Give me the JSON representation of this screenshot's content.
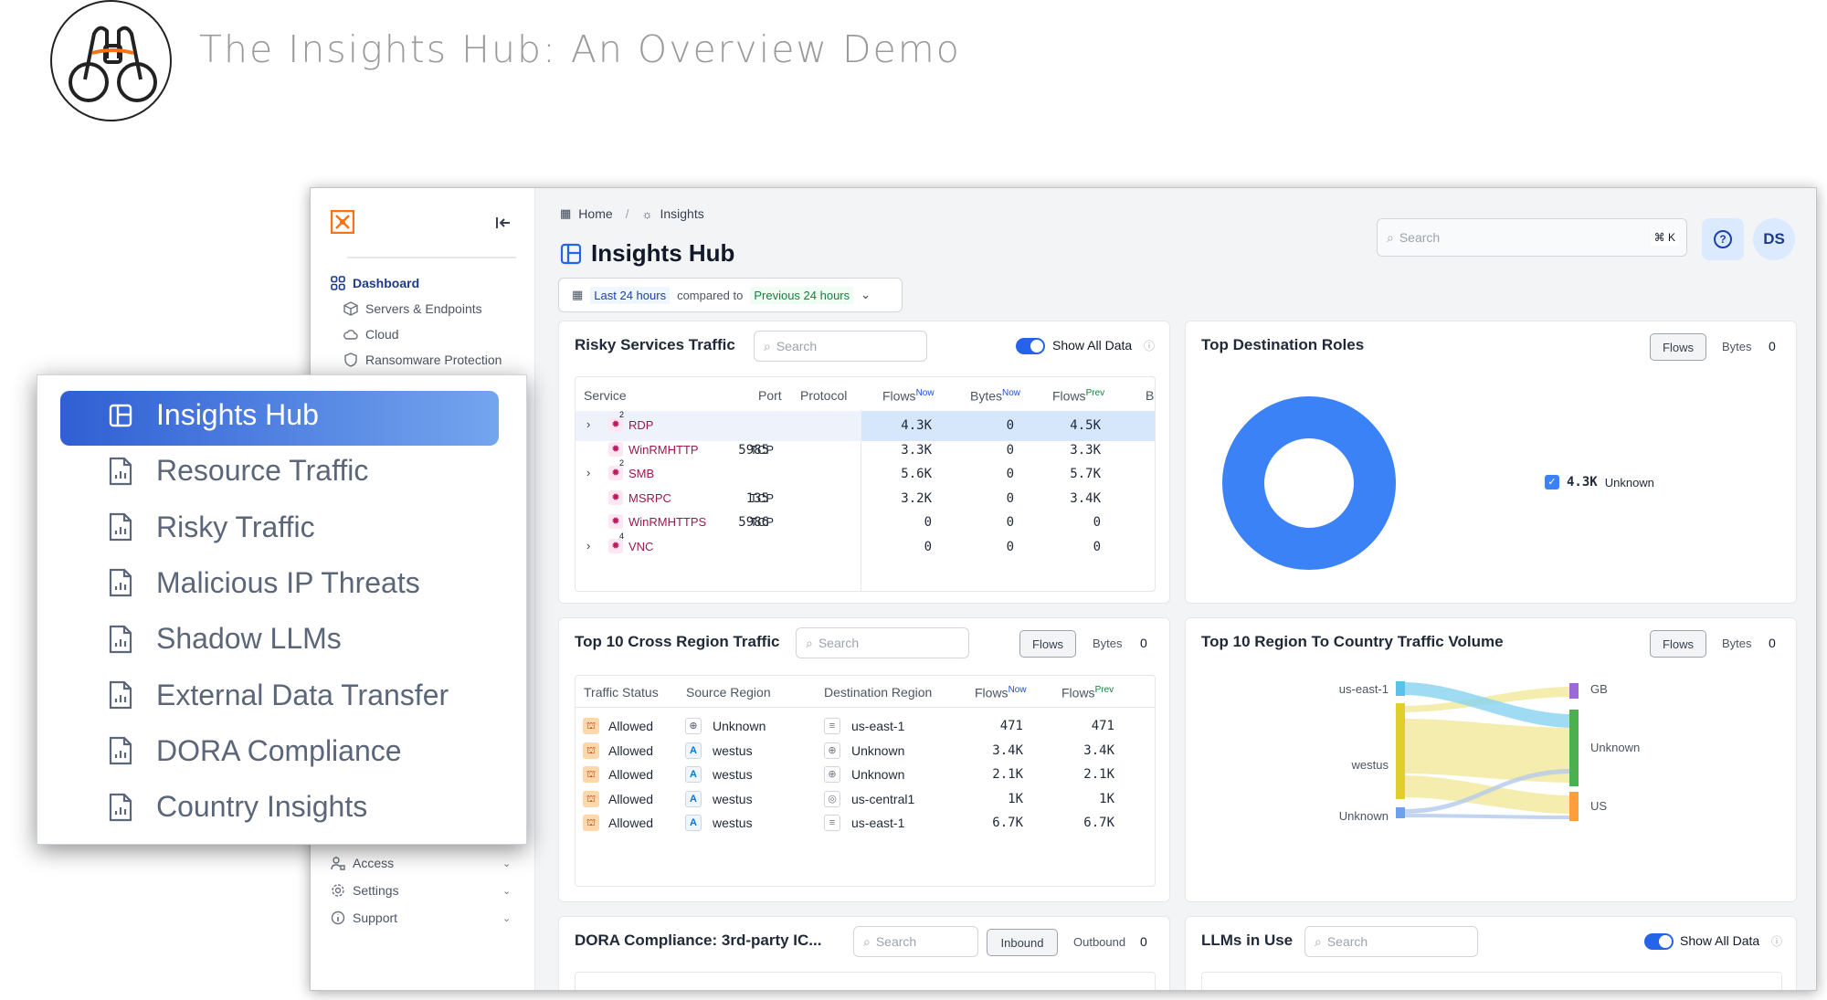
{
  "slide": {
    "title": "The Insights Hub: An Overview Demo"
  },
  "sidebar": {
    "items": [
      {
        "label": "Dashboard"
      },
      {
        "label": "Servers & Endpoints"
      },
      {
        "label": "Cloud"
      },
      {
        "label": "Ransomware Protection"
      },
      {
        "label": "Access"
      },
      {
        "label": "Settings"
      },
      {
        "label": "Support"
      }
    ]
  },
  "header": {
    "breadcrumb_home": "Home",
    "breadcrumb_sep": "/",
    "breadcrumb_current": "Insights",
    "page_title": "Insights Hub",
    "search_placeholder": "Search",
    "shortcut": "⌘ K",
    "help": "?",
    "avatar": "DS"
  },
  "timerange": {
    "current": "Last 24 hours",
    "compared": "compared to",
    "previous": "Previous 24 hours"
  },
  "risky": {
    "title": "Risky Services Traffic",
    "search": "Search",
    "toggle_label": "Show All Data",
    "cols": [
      "Service",
      "Port",
      "Protocol",
      "Flows",
      "Now",
      "Bytes",
      "Now",
      "Flows",
      "Prev",
      "B"
    ],
    "rows": [
      {
        "service": "RDP",
        "badge": "2",
        "port": "",
        "proto": "",
        "flows_now": "4.3K",
        "bytes_now": "0",
        "flows_prev": "4.5K"
      },
      {
        "service": "WinRMHTTP",
        "badge": "",
        "port": "5985",
        "proto": "TCP",
        "flows_now": "3.3K",
        "bytes_now": "0",
        "flows_prev": "3.3K"
      },
      {
        "service": "SMB",
        "badge": "2",
        "port": "",
        "proto": "",
        "flows_now": "5.6K",
        "bytes_now": "0",
        "flows_prev": "5.7K"
      },
      {
        "service": "MSRPC",
        "badge": "",
        "port": "135",
        "proto": "TCP",
        "flows_now": "3.2K",
        "bytes_now": "0",
        "flows_prev": "3.4K"
      },
      {
        "service": "WinRMHTTPS",
        "badge": "",
        "port": "5986",
        "proto": "TCP",
        "flows_now": "0",
        "bytes_now": "0",
        "flows_prev": "0"
      },
      {
        "service": "VNC",
        "badge": "4",
        "port": "",
        "proto": "",
        "flows_now": "0",
        "bytes_now": "0",
        "flows_prev": "0"
      }
    ]
  },
  "dest": {
    "title": "Top Destination Roles",
    "flows": "Flows",
    "bytes": "Bytes",
    "zero": "0",
    "legend_value": "4.3K",
    "legend_label": "Unknown"
  },
  "cross": {
    "title": "Top 10 Cross Region Traffic",
    "search": "Search",
    "flows": "Flows",
    "bytes": "Bytes",
    "zero": "0",
    "cols": [
      "Traffic Status",
      "Source Region",
      "Destination Region",
      "Flows",
      "Now",
      "Flows",
      "Prev"
    ],
    "rows": [
      {
        "status": "Allowed",
        "src": "Unknown",
        "dst": "us-east-1",
        "now": "471",
        "prev": "471"
      },
      {
        "status": "Allowed",
        "src": "westus",
        "dst": "Unknown",
        "now": "3.4K",
        "prev": "3.4K"
      },
      {
        "status": "Allowed",
        "src": "westus",
        "dst": "Unknown",
        "now": "2.1K",
        "prev": "2.1K"
      },
      {
        "status": "Allowed",
        "src": "westus",
        "dst": "us-central1",
        "now": "1K",
        "prev": "1K"
      },
      {
        "status": "Allowed",
        "src": "westus",
        "dst": "us-east-1",
        "now": "6.7K",
        "prev": "6.7K"
      }
    ]
  },
  "country": {
    "title": "Top 10 Region To Country Traffic Volume",
    "flows": "Flows",
    "bytes": "Bytes",
    "zero": "0",
    "left": [
      "us-east-1",
      "westus",
      "Unknown"
    ],
    "right": [
      "GB",
      "Unknown",
      "US"
    ]
  },
  "dora": {
    "title": "DORA Compliance: 3rd-party IC...",
    "search": "Search",
    "inbound": "Inbound",
    "outbound": "Outbound",
    "zero": "0"
  },
  "llm": {
    "title": "LLMs in Use",
    "search": "Search",
    "toggle_label": "Show All Data"
  },
  "overlay": {
    "items": [
      "Insights Hub",
      "Resource Traffic",
      "Risky Traffic",
      "Malicious IP Threats",
      "Shadow LLMs",
      "External Data Transfer",
      "DORA Compliance",
      "Country Insights"
    ]
  },
  "colors": {
    "accent": "#2563eb",
    "donut": "#3b82f6",
    "brand": "#f97316"
  }
}
